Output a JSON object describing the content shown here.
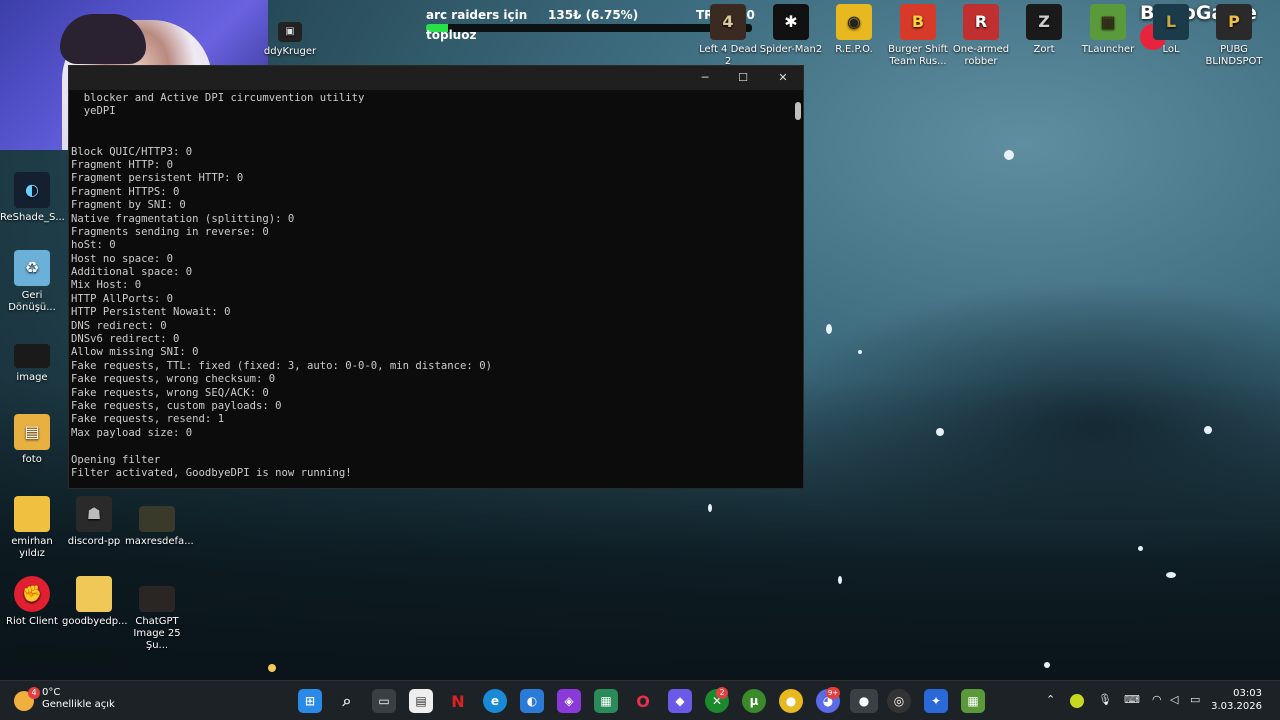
{
  "overlay": {
    "title": "arc raiders için",
    "subtitle": "topluoz",
    "stat": "135₺ (6.75%)",
    "goal": "TRY2000",
    "progress": 0.0675,
    "brand": "ByNoGame"
  },
  "desktop_icons_top": [
    {
      "label": "Left 4 Dead 2"
    },
    {
      "label": "Spider-Man2"
    },
    {
      "label": "R.E.P.O."
    },
    {
      "label": "Burger Shift Team Rus..."
    },
    {
      "label": "One-armed robber"
    },
    {
      "label": "Zort"
    },
    {
      "label": "TLauncher"
    },
    {
      "label": "LoL"
    },
    {
      "label": "PUBG BLINDSPOT"
    }
  ],
  "desktop_icons_left": [
    {
      "label": "ddyKruger"
    },
    {
      "label": "ReShade_S..."
    },
    {
      "label": "Geri Dönüşü..."
    },
    {
      "label": "image"
    },
    {
      "label": "foto"
    },
    {
      "label": "emirhan yıldız"
    },
    {
      "label": "discord-pp"
    },
    {
      "label": "maxresdefa..."
    },
    {
      "label": "Riot Client"
    },
    {
      "label": "goodbyedp..."
    },
    {
      "label": "ChatGPT Image 25 Şu..."
    }
  ],
  "terminal": {
    "lines": [
      "  blocker and Active DPI circumvention utility",
      "  yeDPI",
      "",
      "",
      "Block QUIC/HTTP3: 0",
      "Fragment HTTP: 0",
      "Fragment persistent HTTP: 0",
      "Fragment HTTPS: 0",
      "Fragment by SNI: 0",
      "Native fragmentation (splitting): 0",
      "Fragments sending in reverse: 0",
      "hoSt: 0",
      "Host no space: 0",
      "Additional space: 0",
      "Mix Host: 0",
      "HTTP AllPorts: 0",
      "HTTP Persistent Nowait: 0",
      "DNS redirect: 0",
      "DNSv6 redirect: 0",
      "Allow missing SNI: 0",
      "Fake requests, TTL: fixed (fixed: 3, auto: 0-0-0, min distance: 0)",
      "Fake requests, wrong checksum: 0",
      "Fake requests, wrong SEQ/ACK: 0",
      "Fake requests, custom payloads: 0",
      "Fake requests, resend: 1",
      "Max payload size: 0",
      "",
      "Opening filter",
      "Filter activated, GoodbyeDPI is now running!"
    ],
    "minimize": "─",
    "maximize": "☐",
    "close": "✕"
  },
  "taskbar": {
    "temp": "0°C",
    "weather": "Genellikle açık",
    "weather_badge": "4",
    "time": "03:03",
    "date": "3.03.2026",
    "xbox_badge": "2",
    "discord_badge": "9+"
  }
}
